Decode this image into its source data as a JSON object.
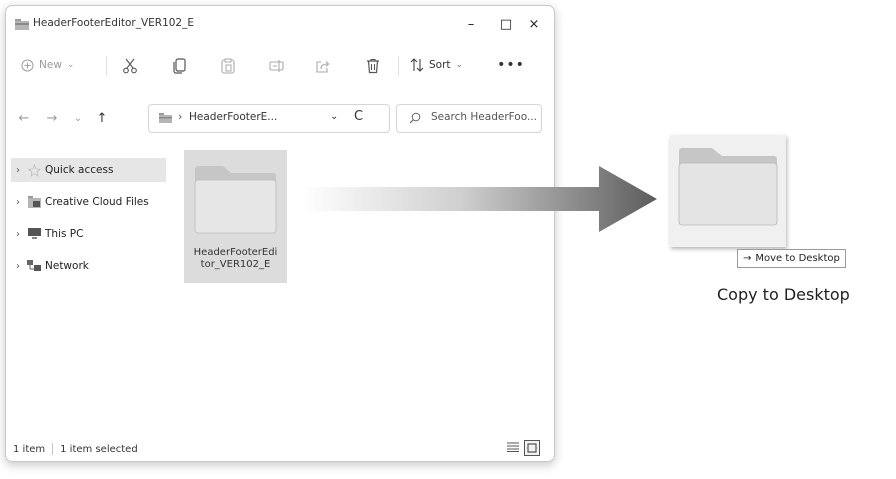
{
  "window": {
    "title": "HeaderFooterEditor_VER102_E",
    "controls": {
      "minimize": "–",
      "maximize": "□",
      "close": "×"
    }
  },
  "toolbar": {
    "new_label": "New",
    "new_chevron": "⌄",
    "sort_label": "Sort",
    "sort_chevron": "⌄",
    "more_label": "•••",
    "icons": [
      "new-icon",
      "cut-icon",
      "copy-icon",
      "paste-icon",
      "rename-icon",
      "share-icon",
      "delete-icon",
      "sort-icon"
    ]
  },
  "address": {
    "back": "←",
    "forward": "→",
    "history": "⌄",
    "up": "↑",
    "separator": "›",
    "path": "HeaderFooterE...",
    "dropdown": "⌄",
    "refresh": "C",
    "search_placeholder": "Search HeaderFoo..."
  },
  "sidebar": {
    "items": [
      {
        "label": "Quick access",
        "icon": "star-icon",
        "selected": true
      },
      {
        "label": "Creative Cloud Files",
        "icon": "creative-cloud-icon",
        "selected": false
      },
      {
        "label": "This PC",
        "icon": "monitor-icon",
        "selected": false
      },
      {
        "label": "Network",
        "icon": "network-icon",
        "selected": false
      }
    ]
  },
  "content": {
    "folder_name_line1": "HeaderFooterEdi",
    "folder_name_line2": "tor_VER102_E"
  },
  "status": {
    "item_count": "1 item",
    "selected_count": "1 item selected"
  },
  "drag": {
    "tooltip_arrow": "→",
    "tooltip_text": "Move to Desktop",
    "caption": "Copy to Desktop"
  },
  "colors": {
    "selection": "#dcdcdc",
    "arrow_dark": "#606060",
    "folder_body": "#e4e4e4",
    "folder_tab": "#c6c6c6"
  }
}
